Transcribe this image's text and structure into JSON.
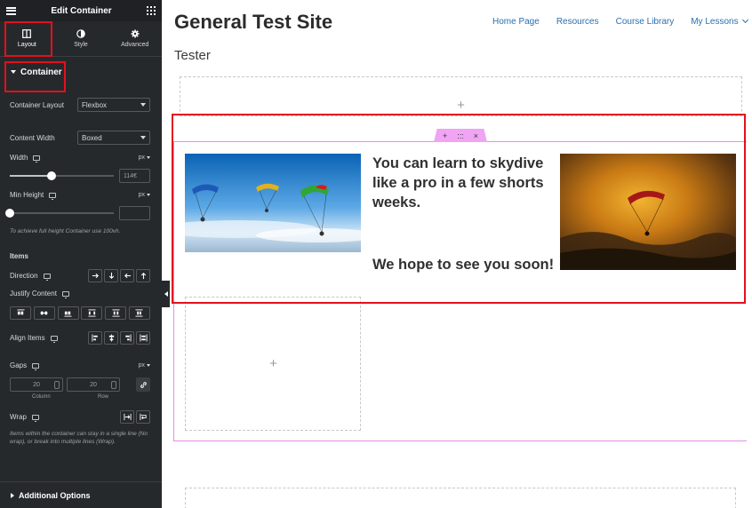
{
  "sidebar": {
    "title": "Edit Container",
    "tabs": [
      {
        "label": "Layout",
        "icon": "layout-icon"
      },
      {
        "label": "Style",
        "icon": "contrast-icon"
      },
      {
        "label": "Advanced",
        "icon": "gear-icon"
      }
    ],
    "section_title": "Container",
    "container_layout": {
      "label": "Container Layout",
      "value": "Flexbox"
    },
    "content_width": {
      "label": "Content Width",
      "value": "Boxed"
    },
    "width": {
      "label": "Width",
      "unit": "px",
      "value": "114€",
      "slider_fraction": 0.4
    },
    "min_height": {
      "label": "Min Height",
      "unit": "px",
      "value": "",
      "slider_fraction": 0.0
    },
    "min_height_hint": "To achieve full height Container use 100vh.",
    "items_heading": "Items",
    "direction": {
      "label": "Direction"
    },
    "justify_content": {
      "label": "Justify Content"
    },
    "align_items": {
      "label": "Align Items"
    },
    "gaps": {
      "label": "Gaps",
      "unit": "px",
      "column_value": "20",
      "row_value": "20",
      "column_label": "Column",
      "row_label": "Row"
    },
    "wrap": {
      "label": "Wrap",
      "hint": "Items within the container can stay in a single line (No wrap), or break into multiple lines (Wrap)."
    },
    "footer": "Additional Options"
  },
  "site": {
    "title": "General Test Site",
    "nav": [
      "Home Page",
      "Resources",
      "Course Library",
      "My Lessons"
    ],
    "page_subtitle": "Tester"
  },
  "container": {
    "controls": [
      "+",
      ":::",
      "×"
    ],
    "heading_1": "You can learn to skydive like a pro in a few shorts weeks.",
    "heading_2": "We hope to see you soon!",
    "add_symbol": "+"
  },
  "colors": {
    "sidebar_bg": "#26292c",
    "highlight_red": "#e3101e",
    "nav_link": "#2a6fb0",
    "selection_pink": "#f0a4f3"
  }
}
